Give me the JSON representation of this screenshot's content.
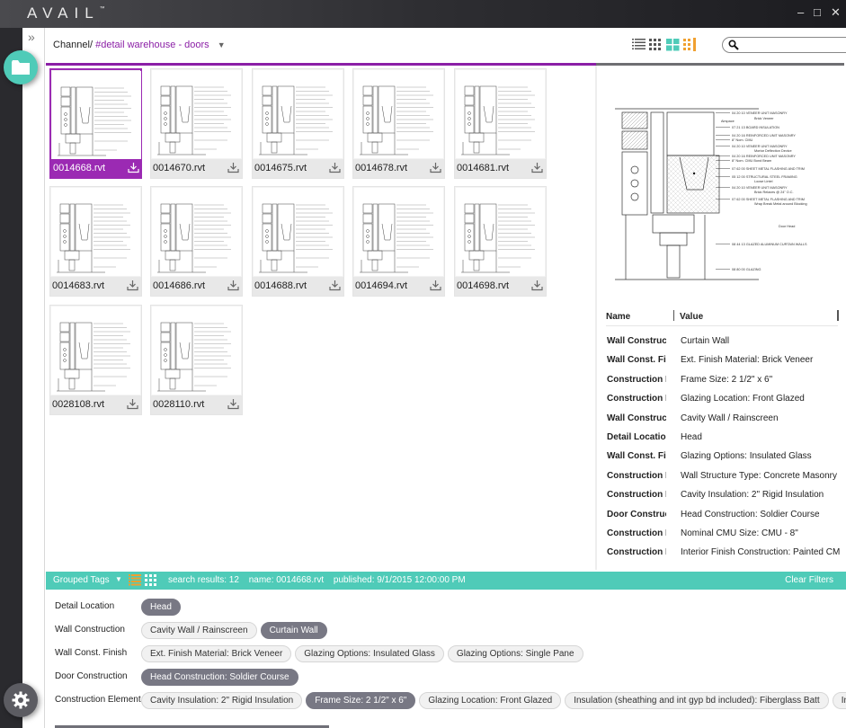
{
  "app": {
    "title": "AVAIL",
    "trademark": "™",
    "window_controls": {
      "minimize": "–",
      "maximize": "□",
      "close": "✕"
    }
  },
  "nav": {
    "collapse_icon": "»",
    "folder_icon": "folder-icon",
    "settings_icon": "gear-icon"
  },
  "header": {
    "breadcrumb_root": "Channel/",
    "channel_name": "#detail warehouse - doors",
    "dropdown_caret": "▼",
    "view_modes": [
      "list-view",
      "small-grid-view",
      "large-grid-view",
      "tile-view"
    ],
    "active_view": "large-grid-view",
    "search": {
      "value": "",
      "placeholder": ""
    }
  },
  "files": [
    {
      "name": "0014668.rvt",
      "selected": true
    },
    {
      "name": "0014670.rvt",
      "selected": false
    },
    {
      "name": "0014675.rvt",
      "selected": false
    },
    {
      "name": "0014678.rvt",
      "selected": false
    },
    {
      "name": "0014681.rvt",
      "selected": false
    },
    {
      "name": "0014683.rvt",
      "selected": false
    },
    {
      "name": "0014686.rvt",
      "selected": false
    },
    {
      "name": "0014688.rvt",
      "selected": false
    },
    {
      "name": "0014694.rvt",
      "selected": false
    },
    {
      "name": "0014698.rvt",
      "selected": false
    },
    {
      "name": "0028108.rvt",
      "selected": false
    },
    {
      "name": "0028110.rvt",
      "selected": false
    }
  ],
  "preview": {
    "labels": [
      "04 20 10 VENEER UNIT MASONRY",
      "Brick Veneer",
      "Airspace",
      "07 21 13 BOARD INSULATION",
      "04 20 16 REINFORCED UNIT MASONRY",
      "8\" Nom. CMU",
      "04 20 10 VENEER UNIT MASONRY",
      "Mortar Deflection Device",
      "04 20 16 REINFORCED UNIT MASONRY",
      "8\" Nom. CMU Bond Beam",
      "07 62 00 SHEET METAL FLASHING AND TRIM",
      "05 12 00 STRUCTURAL STEEL FRAMING",
      "Loose Lintel",
      "04 20 10 VENEER UNIT MASONRY",
      "Brick Relaxes @ 24\" O.C.",
      "07 62 00 SHEET METAL FLASHING AND TRIM",
      "Wrap Break Metal around Blocking",
      "Door Head",
      "08 44 13 GLAZED ALUMINUM CURTAIN WALLS",
      "08 80 00 GLAZING"
    ]
  },
  "properties": {
    "col_name": "Name",
    "col_value": "Value",
    "rows": [
      {
        "name": "Wall Construction",
        "value": "Curtain Wall"
      },
      {
        "name": "Wall Const. Finish",
        "value": "Ext. Finish Material: Brick Veneer"
      },
      {
        "name": "Construction Element",
        "value": "Frame Size: 2 1/2\" x 6\""
      },
      {
        "name": "Construction Element",
        "value": "Glazing Location: Front Glazed"
      },
      {
        "name": "Wall Construction",
        "value": "Cavity Wall / Rainscreen"
      },
      {
        "name": "Detail Location",
        "value": "Head"
      },
      {
        "name": "Wall Const. Finish",
        "value": "Glazing Options: Insulated Glass"
      },
      {
        "name": "Construction Element",
        "value": "Wall Structure Type: Concrete Masonry"
      },
      {
        "name": "Construction Element",
        "value": "Cavity Insulation: 2\" Rigid Insulation"
      },
      {
        "name": "Door Construction",
        "value": "Head Construction: Soldier Course"
      },
      {
        "name": "Construction Element",
        "value": "Nominal CMU Size: CMU - 8\""
      },
      {
        "name": "Construction Element",
        "value": "Interior Finish Construction: Painted CM"
      }
    ]
  },
  "tagbar": {
    "grouping": "Grouped Tags",
    "caret": "▼",
    "search_results": "search results: 12",
    "name": "name: 0014668.rvt",
    "published": "published: 9/1/2015 12:00:00 PM",
    "clear_filters": "Clear Filters"
  },
  "tag_groups": [
    {
      "label": "Detail Location",
      "tags": [
        {
          "text": "Head",
          "on": true
        }
      ]
    },
    {
      "label": "Wall Construction",
      "tags": [
        {
          "text": "Cavity Wall / Rainscreen",
          "on": false
        },
        {
          "text": "Curtain Wall",
          "on": true
        }
      ]
    },
    {
      "label": "Wall Const. Finish",
      "tags": [
        {
          "text": "Ext. Finish Material: Brick Veneer",
          "on": false
        },
        {
          "text": "Glazing Options: Insulated Glass",
          "on": false
        },
        {
          "text": "Glazing Options: Single Pane",
          "on": false
        }
      ]
    },
    {
      "label": "Door Construction",
      "tags": [
        {
          "text": "Head Construction: Soldier Course",
          "on": true
        }
      ]
    },
    {
      "label": "Construction Element",
      "tags": [
        {
          "text": "Cavity Insulation: 2\" Rigid Insulation",
          "on": false
        },
        {
          "text": "Frame Size: 2 1/2\" x 6\"",
          "on": true
        },
        {
          "text": "Glazing Location: Front Glazed",
          "on": false
        },
        {
          "text": "Insulation (sheathing and int gyp bd included): Fiberglass Batt",
          "on": false
        },
        {
          "text": "Interior Finish Construction: Painted CM",
          "on": false
        }
      ]
    }
  ],
  "colors": {
    "accent_purple": "#9b2ab3",
    "accent_teal": "#4fcbb8",
    "chip_active": "#787884",
    "view_icon_orange": "#f0a030"
  }
}
